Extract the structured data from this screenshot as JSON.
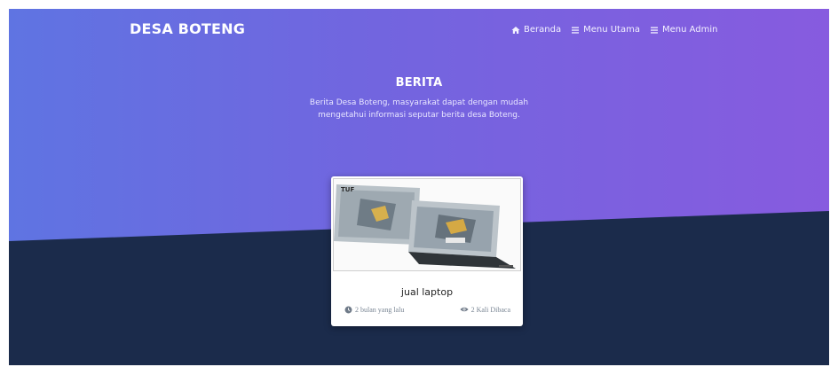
{
  "brand": {
    "name": "DESA BOTENG"
  },
  "nav": {
    "items": [
      {
        "label": "Beranda",
        "icon": "home-icon"
      },
      {
        "label": "Menu Utama",
        "icon": "bars-icon"
      },
      {
        "label": "Menu Admin",
        "icon": "bars-icon"
      }
    ]
  },
  "hero": {
    "title": "BERITA",
    "description_line1": "Berita Desa Boteng, masyarakat dapat dengan mudah",
    "description_line2": "mengetahui informasi seputar berita desa Boteng."
  },
  "card": {
    "title": "jual laptop",
    "time_label": "2 bulan yang lalu",
    "time_icon": "clock-icon",
    "views_label": "2 Kali Dibaca",
    "views_icon": "eye-icon",
    "image_icon": "laptop-image"
  },
  "colors": {
    "gradient_start": "#5f74e2",
    "gradient_end": "#875bdf",
    "dark_bg": "#1b2b4b",
    "card_bg": "#ffffff"
  }
}
